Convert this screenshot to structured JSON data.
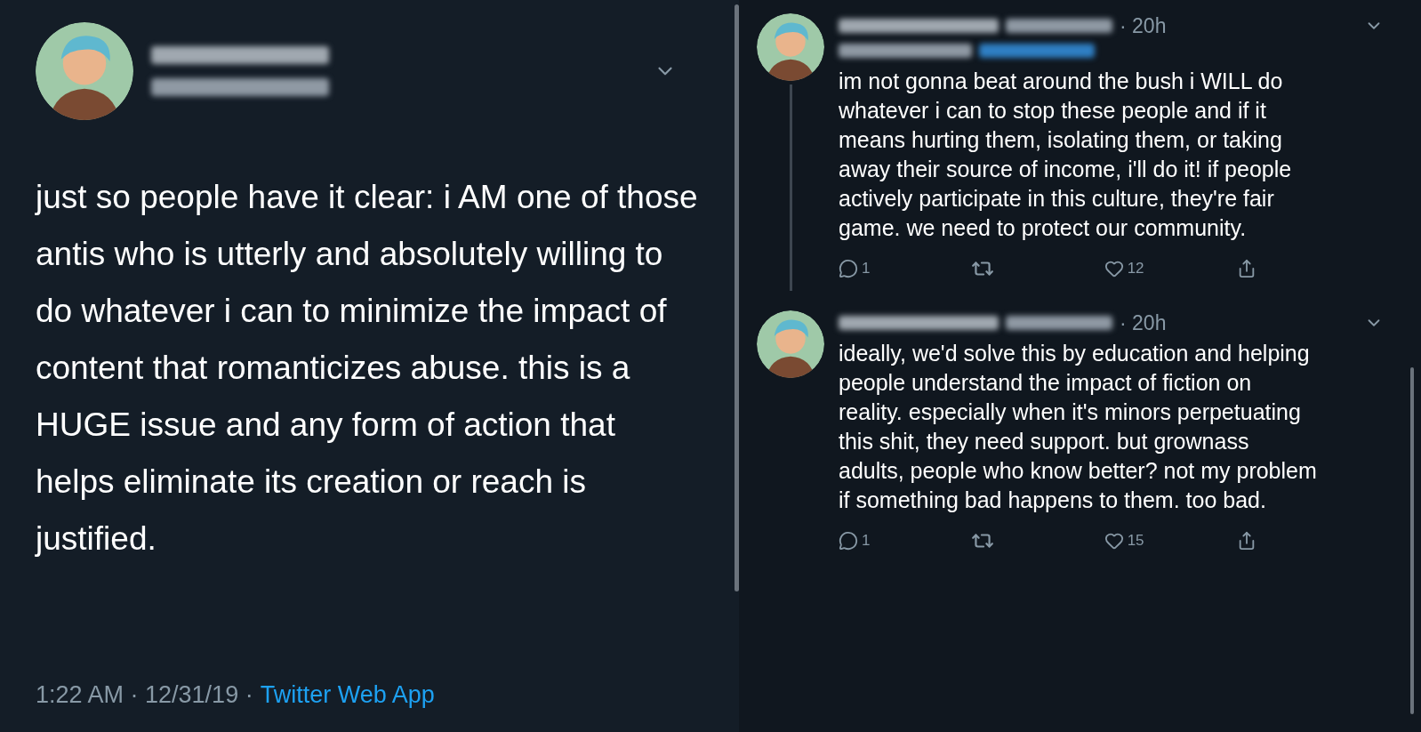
{
  "main_tweet": {
    "text": "just so people have it clear: i AM one of those antis who is utterly and absolutely willing to do whatever i can to minimize the impact of content that romanticizes abuse. this is a HUGE issue and any form of action that helps eliminate its creation or reach is justified.",
    "meta": "1:22 AM · 12/31/19 ·",
    "source": "Twitter Web App"
  },
  "replies": [
    {
      "time": "· 20h",
      "replying_line": true,
      "text": "im not gonna beat around the bush i WILL do whatever i can to stop these people and if it means hurting them, isolating them, or taking away their source of income, i'll do it! if people actively participate in this culture, they're fair game. we need to protect our community.",
      "reply_count": "1",
      "like_count": "12",
      "thread_line": true
    },
    {
      "time": "· 20h",
      "replying_line": false,
      "text": "ideally, we'd solve this by education and helping people understand the impact of fiction on reality. especially when it's minors perpetuating this shit, they need support. but grownass adults, people who know better? not my problem if something bad happens to them. too bad.",
      "reply_count": "1",
      "like_count": "15",
      "thread_line": false
    }
  ]
}
